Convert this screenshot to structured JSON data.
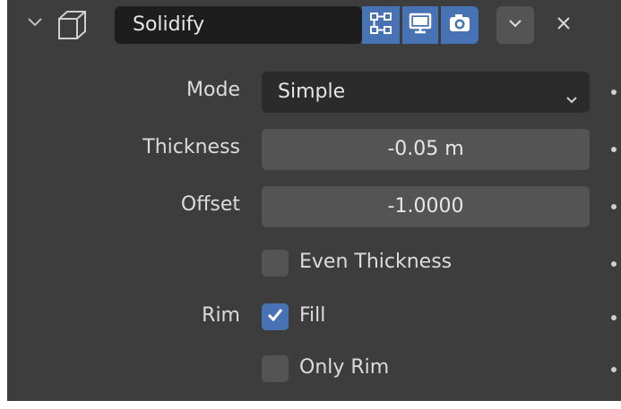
{
  "header": {
    "modifier_name": "Solidify",
    "icons": {
      "collapse": "chevron-down-icon",
      "modifier_type": "solidify-cube-icon",
      "edit_mode": "edit-mode-icon",
      "viewport": "monitor-icon",
      "render": "camera-icon",
      "menu": "chevron-down-icon",
      "delete": "close-icon"
    },
    "toggles_enabled": {
      "edit_mode": true,
      "viewport": true,
      "render": true
    }
  },
  "properties": {
    "mode": {
      "label": "Mode",
      "value": "Simple"
    },
    "thickness": {
      "label": "Thickness",
      "value": "-0.05 m"
    },
    "offset": {
      "label": "Offset",
      "value": "-1.0000"
    },
    "even_thickness": {
      "label": "Even Thickness",
      "checked": false
    },
    "rim": {
      "label": "Rim",
      "fill": {
        "label": "Fill",
        "checked": true
      },
      "only_rim": {
        "label": "Only Rim",
        "checked": false
      }
    }
  },
  "colors": {
    "panel_bg": "#3d3d3d",
    "accent": "#4772b3",
    "field_bg": "#545454",
    "dropdown_bg": "#2b2b2b"
  }
}
